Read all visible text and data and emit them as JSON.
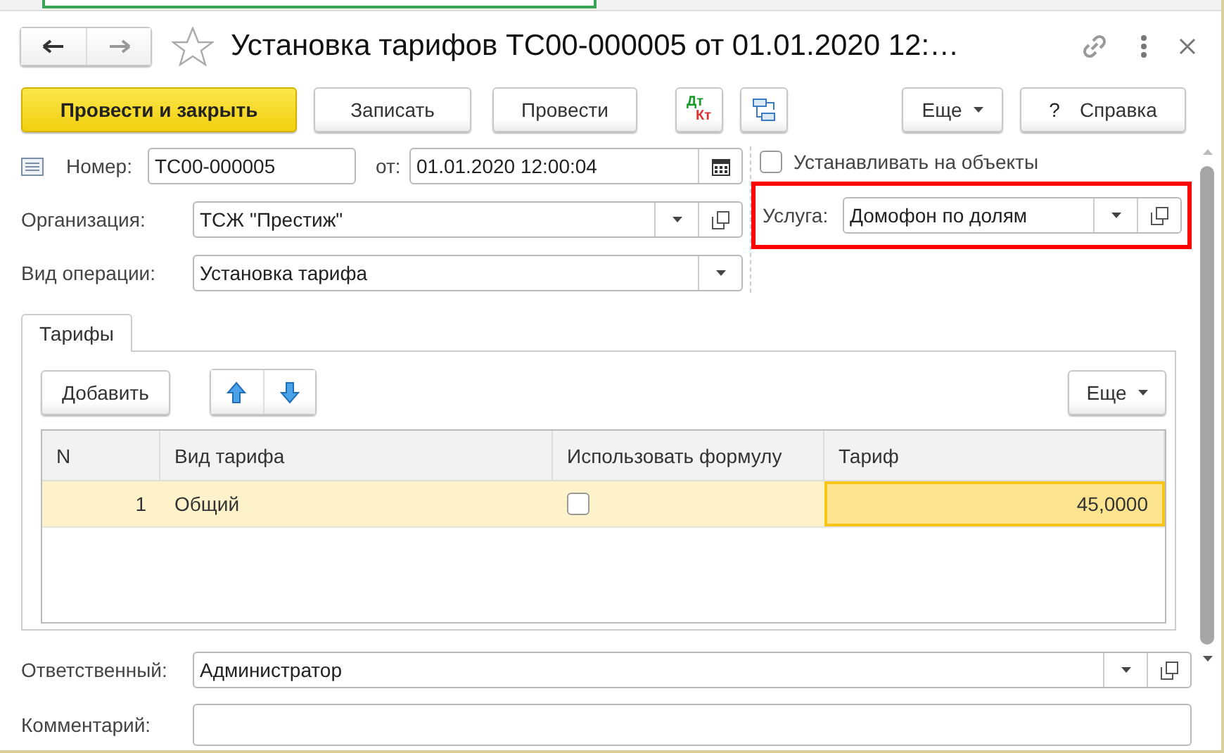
{
  "window": {
    "title": "Установка тарифов ТС00-000005 от 01.01.2020 12:…",
    "favorite": false
  },
  "toolbar": [
    {
      "kind": "primary",
      "label": "Провести и закрыть"
    },
    {
      "kind": "button",
      "label": "Записать"
    },
    {
      "kind": "button",
      "label": "Провести"
    },
    {
      "kind": "dtkt",
      "top": "Дт",
      "bottom": "Кт"
    },
    {
      "kind": "structure"
    },
    {
      "kind": "menu",
      "label": "Еще"
    },
    {
      "kind": "help",
      "icon": "?",
      "label": "Справка"
    }
  ],
  "number": {
    "label": "Номер:",
    "value": "ТС00-000005"
  },
  "date": {
    "label": "от:",
    "value": "01.01.2020 12:00:04"
  },
  "organization": {
    "label": "Организация:",
    "value": "ТСЖ \"Престиж\""
  },
  "operation": {
    "label": "Вид операции:",
    "value": "Установка тарифа"
  },
  "apply_to_objects": {
    "label": "Устанавливать на объекты",
    "checked": false
  },
  "service": {
    "label": "Услуга:",
    "value": "Домофон по долям",
    "highlighted": true
  },
  "tabs": [
    {
      "label": "Тарифы",
      "selected": true
    }
  ],
  "table_toolbar": {
    "add": "Добавить",
    "more": "Еще"
  },
  "table": {
    "columns": [
      "N",
      "Вид тарифа",
      "Использовать формулу",
      "Тариф"
    ],
    "rows": [
      {
        "n": "1",
        "type": "Общий",
        "use_formula": false,
        "tariff": "45,0000",
        "selected": true
      }
    ]
  },
  "responsible": {
    "label": "Ответственный:",
    "value": "Администратор"
  },
  "comment": {
    "label": "Комментарий:"
  }
}
